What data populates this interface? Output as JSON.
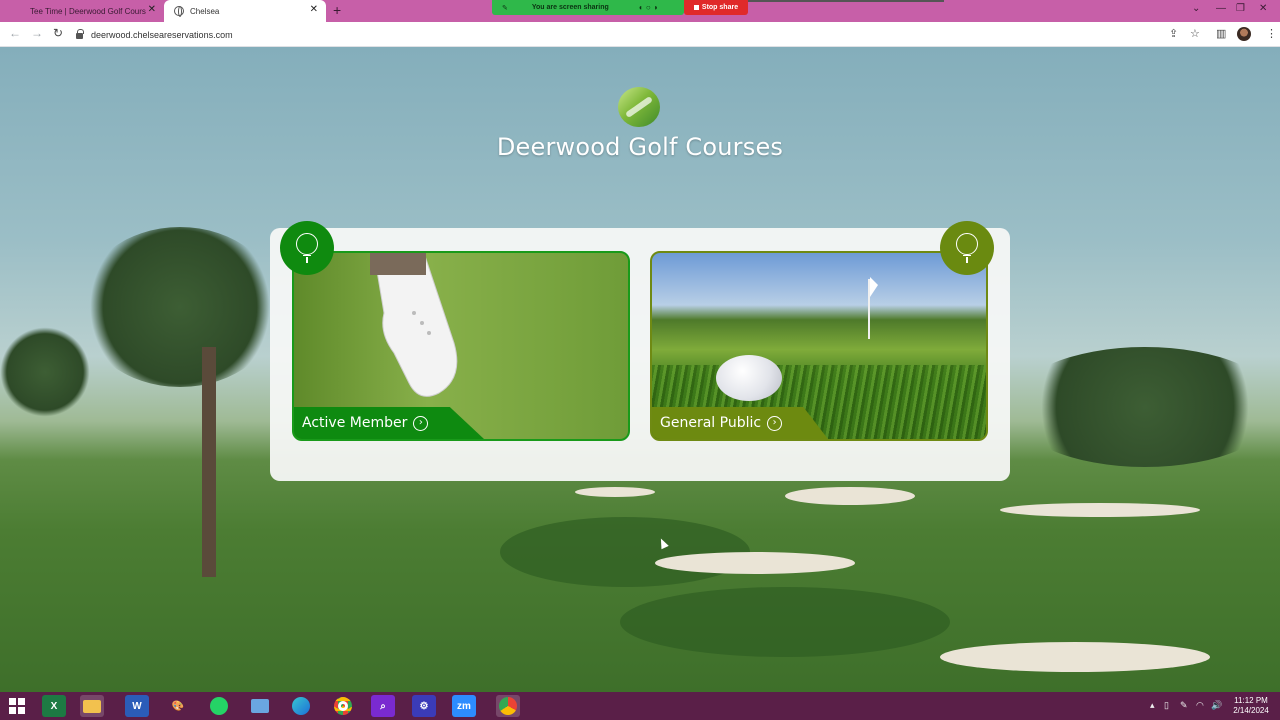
{
  "browser": {
    "tabs": [
      {
        "title": "Tee Time | Deerwood Golf Cours",
        "active": false
      },
      {
        "title": "Chelsea",
        "active": true
      }
    ],
    "screen_share": {
      "text": "You are screen sharing",
      "stop_label": "Stop share"
    },
    "url": "deerwood.chelseareservations.com"
  },
  "site": {
    "title": "Deerwood Golf Courses"
  },
  "cards": [
    {
      "label": "Active Member",
      "color": "#0e8a10"
    },
    {
      "label": "General Public",
      "color": "#6d8a10"
    }
  ],
  "taskbar": {
    "apps": [
      "windows-start",
      "excel",
      "file-explorer",
      "word",
      "paint",
      "whatsapp",
      "remote-desktop",
      "edge",
      "chrome",
      "search-app",
      "settings",
      "zoom",
      "chrome-active"
    ],
    "time": "11:12 PM",
    "date": "2/14/2024"
  },
  "colors": {
    "tabstrip": "#c75fa8",
    "taskbar": "#5a1f48",
    "accent_green": "#0e8a10",
    "accent_olive": "#6d8a10"
  }
}
